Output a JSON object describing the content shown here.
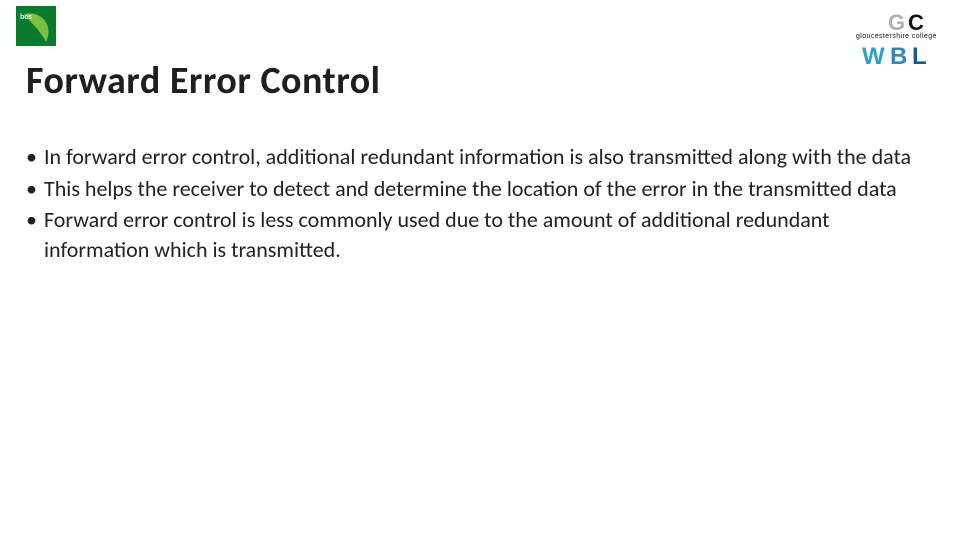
{
  "slide": {
    "title": "Forward Error Control",
    "bullets": [
      "In forward error control, additional redundant information is also transmitted along with the data",
      "This helps the receiver to detect and determine the location of the error in the transmitted data",
      "Forward error control is less commonly used due to the amount of additional redundant information which is transmitted."
    ]
  },
  "logos": {
    "bcs_label": "bcs",
    "gc_label": "gloucestershire college",
    "wbl_label": "WBL"
  }
}
